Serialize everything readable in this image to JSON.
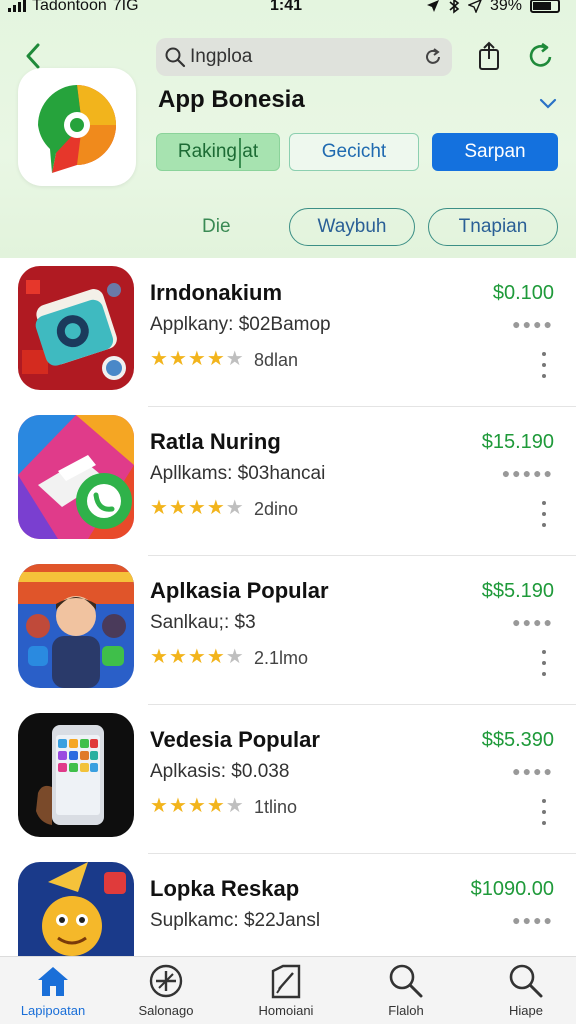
{
  "status_bar": {
    "carrier": "Tadontoon",
    "network": "7IG",
    "time": "1:41",
    "battery": "39%"
  },
  "search": {
    "value": "Ingploa",
    "placeholder": ""
  },
  "app": {
    "name": "App Bonesia"
  },
  "actions": {
    "ranking_label": "Raking at",
    "gecicht_label": "Gecicht",
    "sarpan_label": "Sarpan"
  },
  "filters": {
    "label": "Die",
    "pill_1": "Waybuh",
    "pill_2": "Tnapian"
  },
  "colors": {
    "accent_blue": "#1471de",
    "price_green": "#1f9a3a",
    "star": "#f2b41c",
    "header_bg": "#e4f5df"
  },
  "list": [
    {
      "title": "Irndonakium",
      "subtitle": "Applkany: $02Bamop",
      "price": "$0.100",
      "stars": 4,
      "rating_text": "8dlan",
      "icon": "cube-app-icon"
    },
    {
      "title": "Ratla Nuring",
      "subtitle": "Apllkams: $03hancai",
      "price": "$15.190",
      "stars": 4,
      "rating_text": "2dino",
      "icon": "phone-app-icon"
    },
    {
      "title": "Aplkasia Popular",
      "subtitle": "Sanlkau;: $3",
      "price": "$$5.190",
      "stars": 4,
      "rating_text": "2.1lmo",
      "icon": "game-app-icon"
    },
    {
      "title": "Vedesia Popular",
      "subtitle": "Aplkasis: $0.038",
      "price": "$$5.390",
      "stars": 4,
      "rating_text": "1tlino",
      "icon": "smartphone-app-icon"
    },
    {
      "title": "Lopka Reskap",
      "subtitle": "Suplkamc: $22Jansl",
      "price": "$1090.00",
      "stars": 0,
      "rating_text": "",
      "icon": "character-app-icon"
    }
  ],
  "tabs": [
    {
      "label": "Lapipoatan",
      "icon": "home-icon"
    },
    {
      "label": "Salonago",
      "icon": "compass-icon"
    },
    {
      "label": "Homoiani",
      "icon": "edit-icon"
    },
    {
      "label": "Flaloh",
      "icon": "search-icon"
    },
    {
      "label": "Hiape",
      "icon": "search-icon"
    }
  ]
}
